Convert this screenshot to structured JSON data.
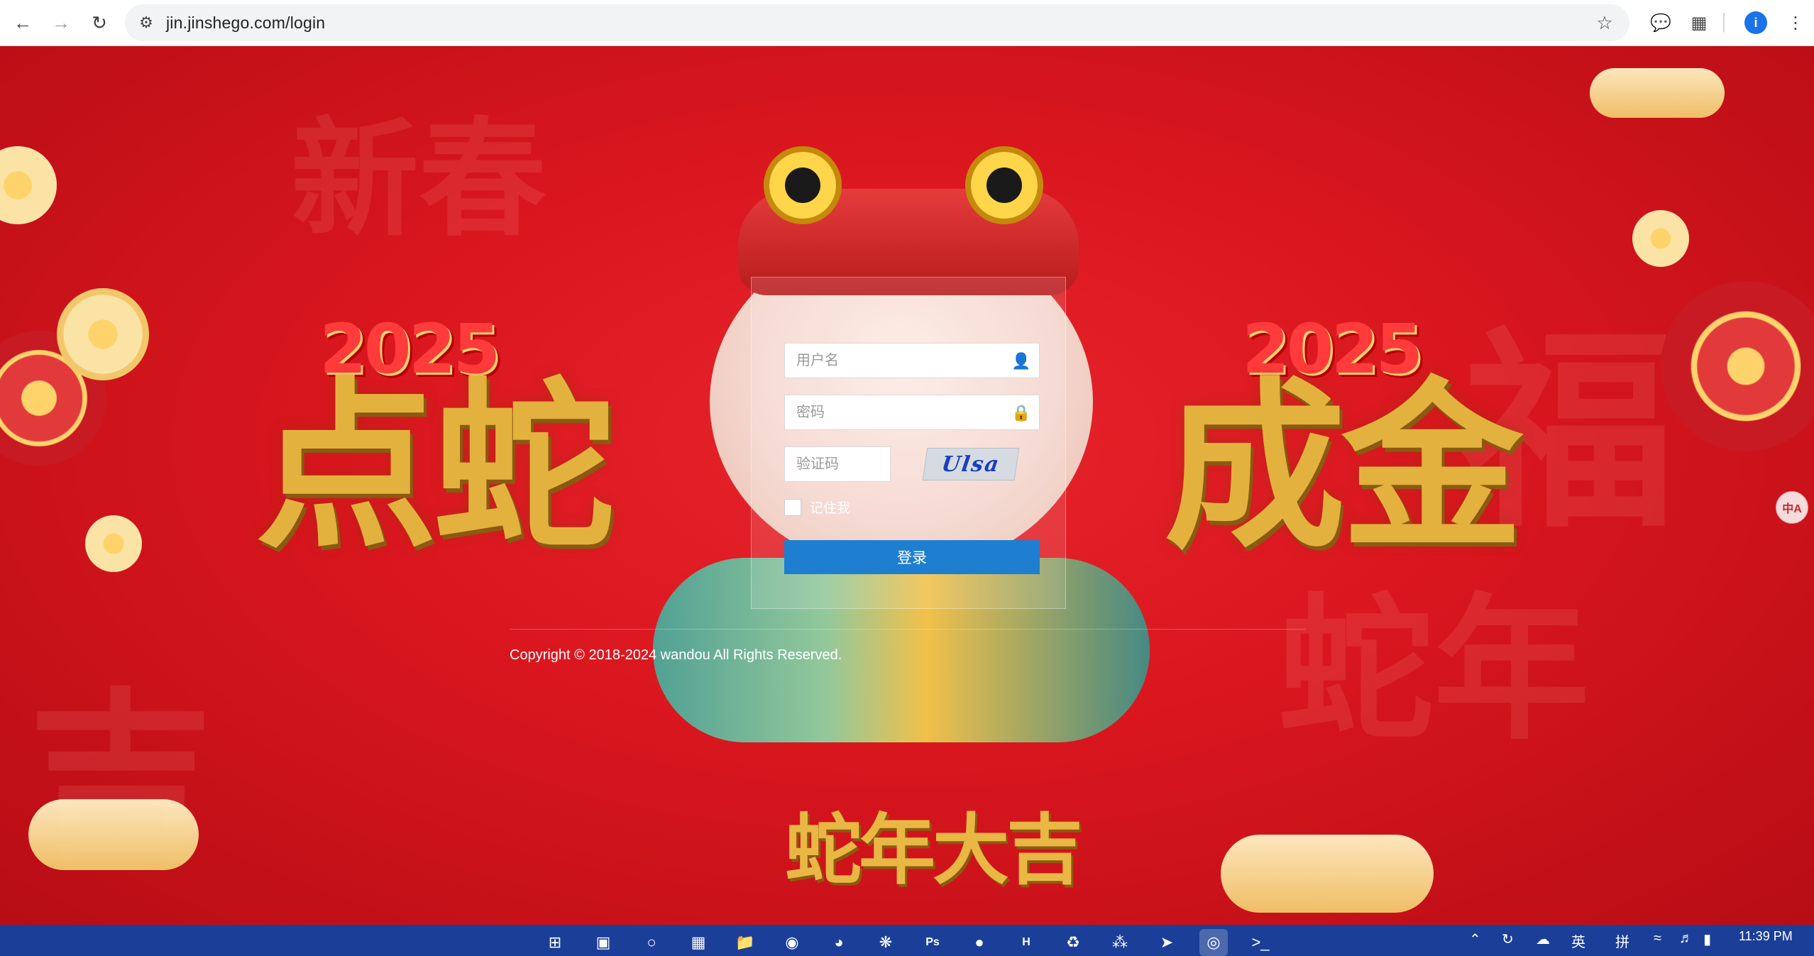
{
  "browser": {
    "url": "jin.jinshego.com/login",
    "icons": [
      "back-arrow-icon",
      "forward-arrow-icon",
      "reload-icon",
      "site-settings-icon",
      "bookmark-star-icon",
      "chat-icon",
      "extensions-icon",
      "profile-avatar-icon"
    ],
    "profile_initial": "i"
  },
  "page": {
    "left_slogan": "点蛇",
    "right_slogan": "成金",
    "badge_left": "2025",
    "badge_right": "2025",
    "bottom_slogan": "蛇年大吉",
    "login": {
      "username_placeholder": "用户名",
      "password_placeholder": "密码",
      "captcha_placeholder": "验证码",
      "captcha_text": "Ulsa",
      "remember_label": "记住我",
      "login_button": "登录"
    },
    "copyright": "Copyright © 2018-2024 wandou All Rights Reserved.",
    "side_widget_text": "中A"
  },
  "taskbar": {
    "apps": [
      "windows-start",
      "file-app",
      "search-app",
      "remote-desktop",
      "file-explorer",
      "github",
      "edge-browser",
      "chatgpt",
      "photoshop",
      "wechat",
      "hbuilder",
      "recycle-app",
      "network-app",
      "telegram",
      "chrome",
      "terminal"
    ],
    "tray_ime_1": "英",
    "tray_ime_2": "拼",
    "time": "11:39 PM"
  },
  "colors": {
    "background_red": "#d9161e",
    "gold": "#e3b23e",
    "button_blue": "#1e7fd0",
    "taskbar_blue": "#1b3f98"
  }
}
